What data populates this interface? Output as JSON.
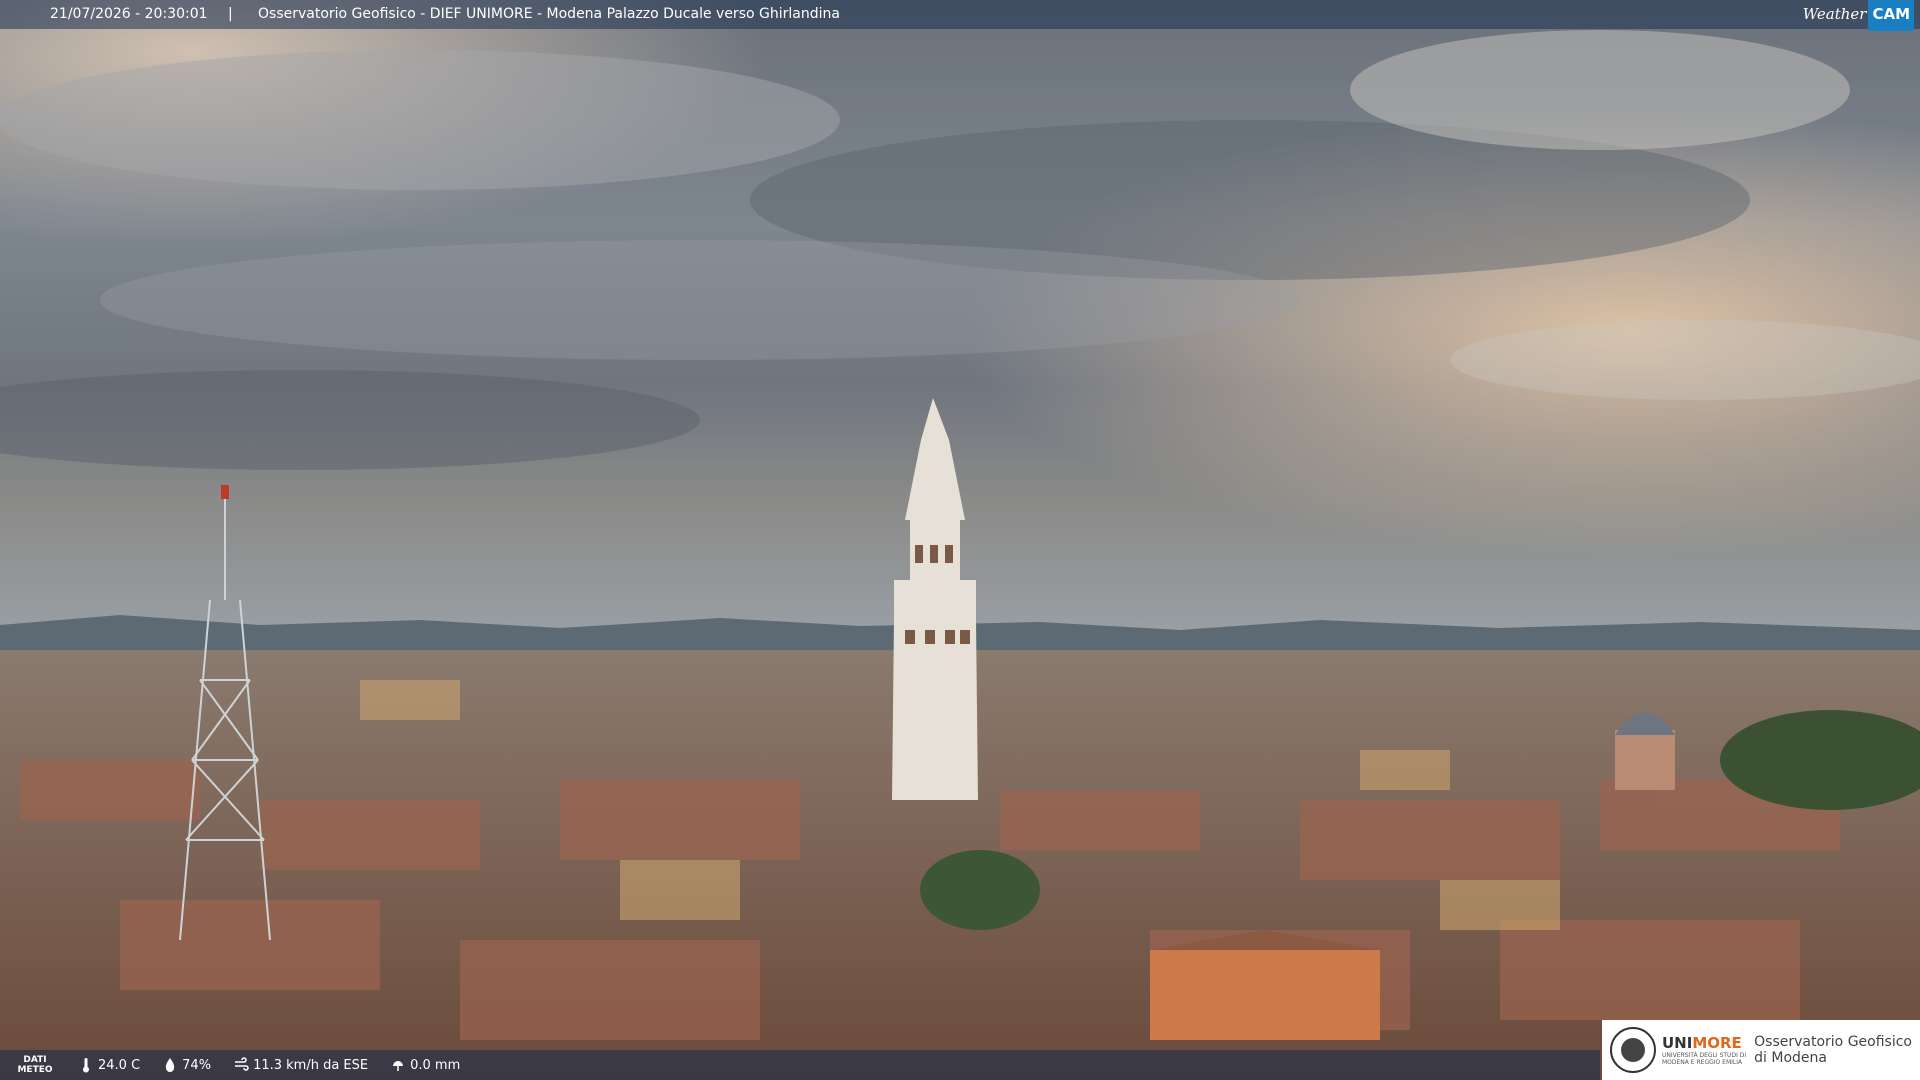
{
  "overlay": {
    "timestamp": "21/07/2026 - 20:30:01",
    "separator": "|",
    "location": "Osservatorio Geofisico - DIEF UNIMORE - Modena Palazzo Ducale verso Ghirlandina",
    "brand_weather": "Weather",
    "brand_cam": "CAM"
  },
  "weather_bar": {
    "label_line1": "DATI",
    "label_line2": "METEO",
    "temperature": "24.0 C",
    "humidity": "74%",
    "wind": "11.3 km/h da ESE",
    "rain": "0.0 mm"
  },
  "logo": {
    "university": "UNI",
    "university_accent": "MORE",
    "university_sub1": "UNIVERSITÀ DEGLI STUDI DI",
    "university_sub2": "MODENA E REGGIO EMILIA",
    "observatory_line1": "Osservatorio Geofisico",
    "observatory_line2": "di Modena"
  },
  "colors": {
    "sky_top": "#5e6670",
    "sky_warm": "#e9c9a8",
    "roof": "#8a5a44",
    "tower": "#e7e0d6",
    "accent_orange": "#e2661b",
    "cam_blue": "#1a7ec2"
  }
}
